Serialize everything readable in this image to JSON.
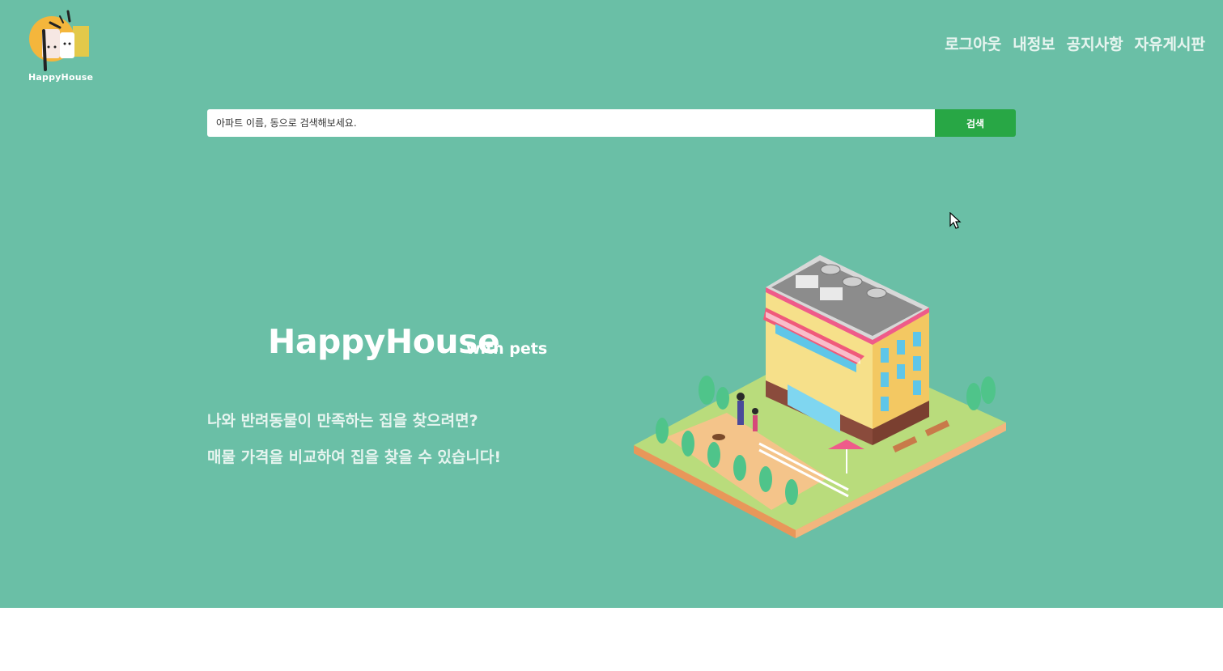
{
  "app": {
    "logo_text": "HappyHouse"
  },
  "nav": {
    "items": [
      {
        "label": "로그아웃"
      },
      {
        "label": "내정보"
      },
      {
        "label": "공지사항"
      },
      {
        "label": "자유게시판"
      }
    ]
  },
  "search": {
    "placeholder": "아파트 이름, 동으로 검색해보세요.",
    "button_label": "검색"
  },
  "hero": {
    "title": "HappyHouse",
    "subtitle": "with pets",
    "line1": "나와 반려동물이 만족하는 집을 찾으려면?",
    "line2": "매물 가격을 비교하여 집을 찾을 수 있습니다!"
  },
  "colors": {
    "background": "#6abfa6",
    "search_button": "#28a745",
    "logo_circle": "#f4b63c"
  },
  "icons": {
    "logo": "happyhouse-logo-icon",
    "illustration": "building-illustration",
    "cursor": "mouse-cursor-icon"
  }
}
